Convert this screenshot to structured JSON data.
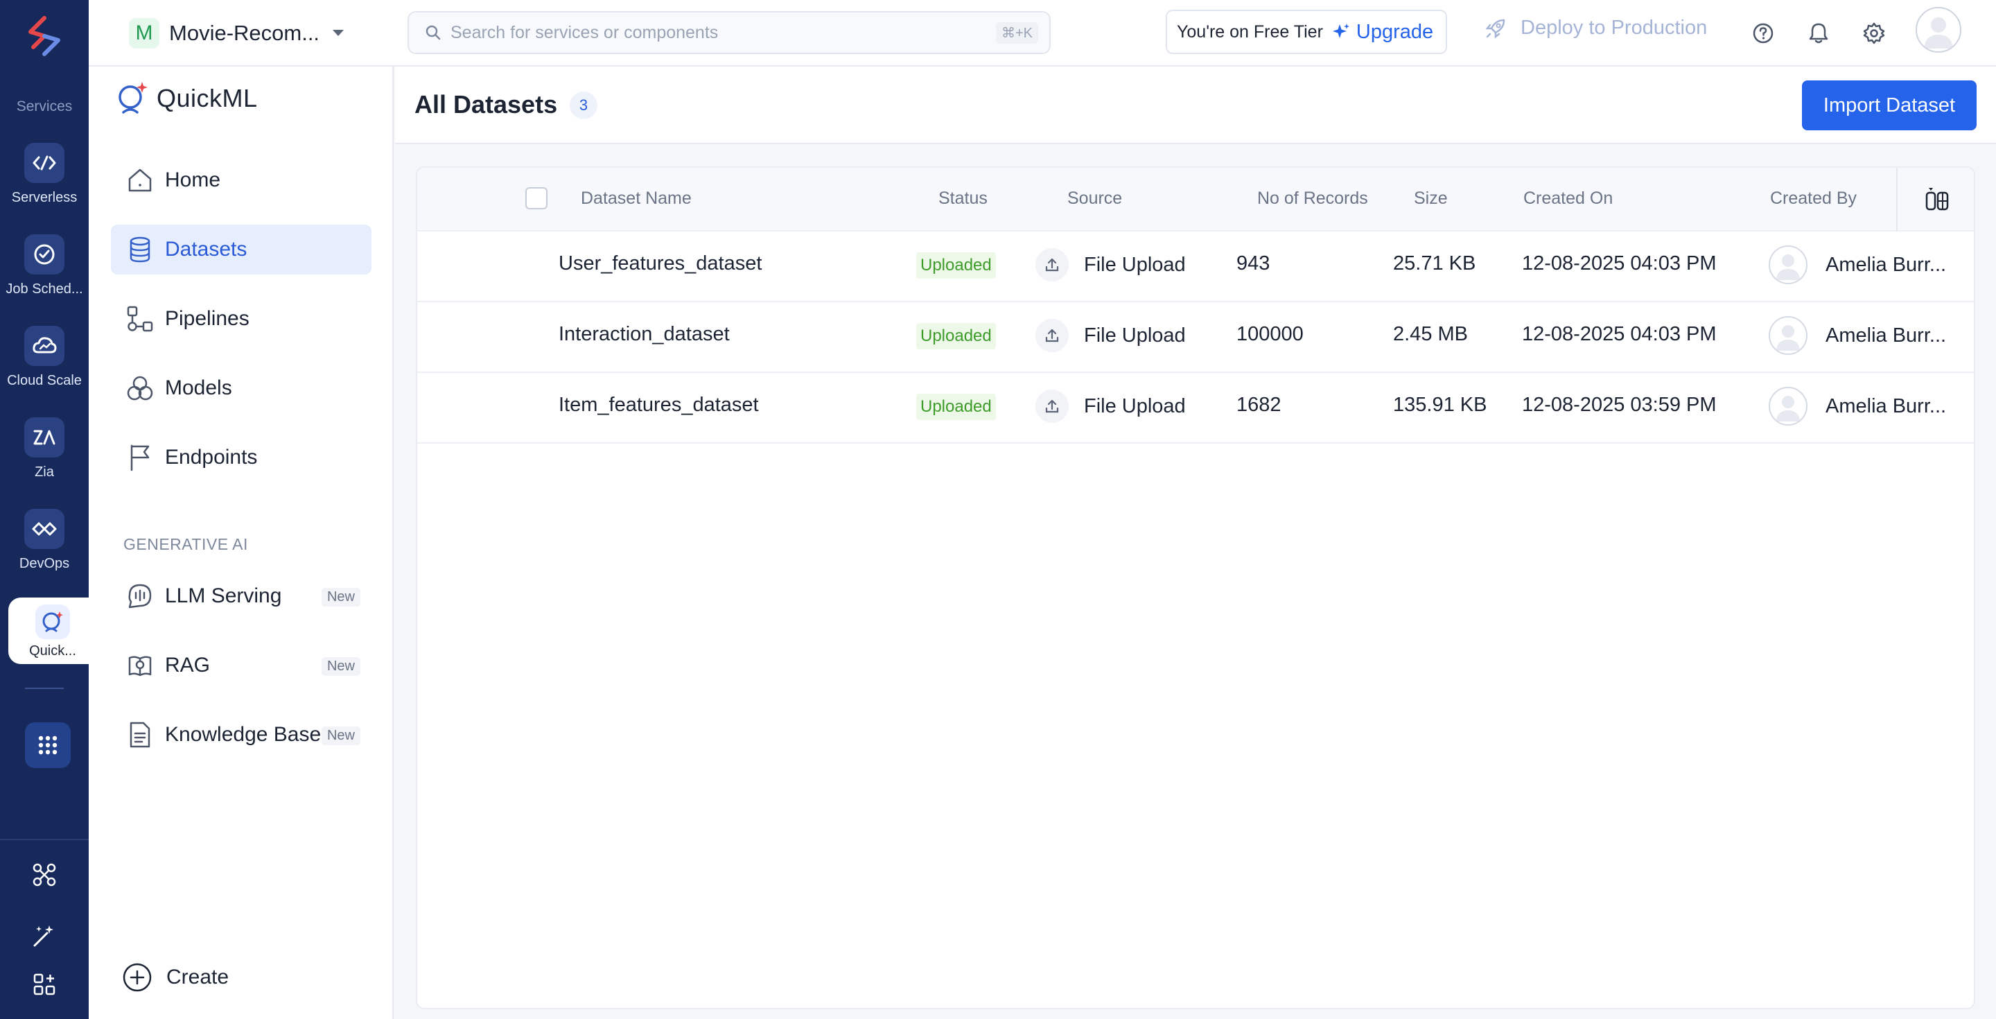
{
  "rail": {
    "section_label": "Services",
    "items": [
      {
        "label": "Serverless",
        "icon": "serverless-icon"
      },
      {
        "label": "Job Sched...",
        "icon": "job-scheduling-icon"
      },
      {
        "label": "Cloud Scale",
        "icon": "cloud-scale-icon"
      },
      {
        "label": "Zia",
        "icon": "zia-icon"
      },
      {
        "label": "DevOps",
        "icon": "devops-icon"
      },
      {
        "label": "Quick...",
        "icon": "quickml-icon",
        "active": true
      }
    ]
  },
  "topbar": {
    "project_initial": "M",
    "project_name": "Movie-Recom...",
    "search_placeholder": "Search for services or components",
    "search_shortcut": "⌘+K",
    "tier_text": "You're on Free Tier",
    "upgrade_label": "Upgrade",
    "deploy_label": "Deploy to Production"
  },
  "sidebar": {
    "brand": "QuickML",
    "nav": [
      {
        "label": "Home"
      },
      {
        "label": "Datasets",
        "active": true
      },
      {
        "label": "Pipelines"
      },
      {
        "label": "Models"
      },
      {
        "label": "Endpoints"
      }
    ],
    "gen_ai_heading": "GENERATIVE AI",
    "gen_ai_nav": [
      {
        "label": "LLM Serving",
        "badge": "New"
      },
      {
        "label": "RAG",
        "badge": "New"
      },
      {
        "label": "Knowledge Base",
        "badge": "New"
      }
    ],
    "create_label": "Create"
  },
  "main": {
    "title": "All Datasets",
    "count": "3",
    "import_label": "Import Dataset",
    "columns": [
      "Dataset Name",
      "Status",
      "Source",
      "No of Records",
      "Size",
      "Created On",
      "Created By"
    ],
    "rows": [
      {
        "name": "User_features_dataset",
        "status": "Uploaded",
        "source": "File Upload",
        "records": "943",
        "size": "25.71 KB",
        "created_on": "12-08-2025 04:03 PM",
        "created_by": "Amelia Burr..."
      },
      {
        "name": "Interaction_dataset",
        "status": "Uploaded",
        "source": "File Upload",
        "records": "100000",
        "size": "2.45 MB",
        "created_on": "12-08-2025 04:03 PM",
        "created_by": "Amelia Burr..."
      },
      {
        "name": "Item_features_dataset",
        "status": "Uploaded",
        "source": "File Upload",
        "records": "1682",
        "size": "135.91 KB",
        "created_on": "12-08-2025 03:59 PM",
        "created_by": "Amelia Burr..."
      }
    ]
  },
  "colors": {
    "rail_bg": "#16295a",
    "accent": "#2563eb",
    "status_green": "#3d9c2a",
    "active_nav_bg": "#e6edfc"
  }
}
